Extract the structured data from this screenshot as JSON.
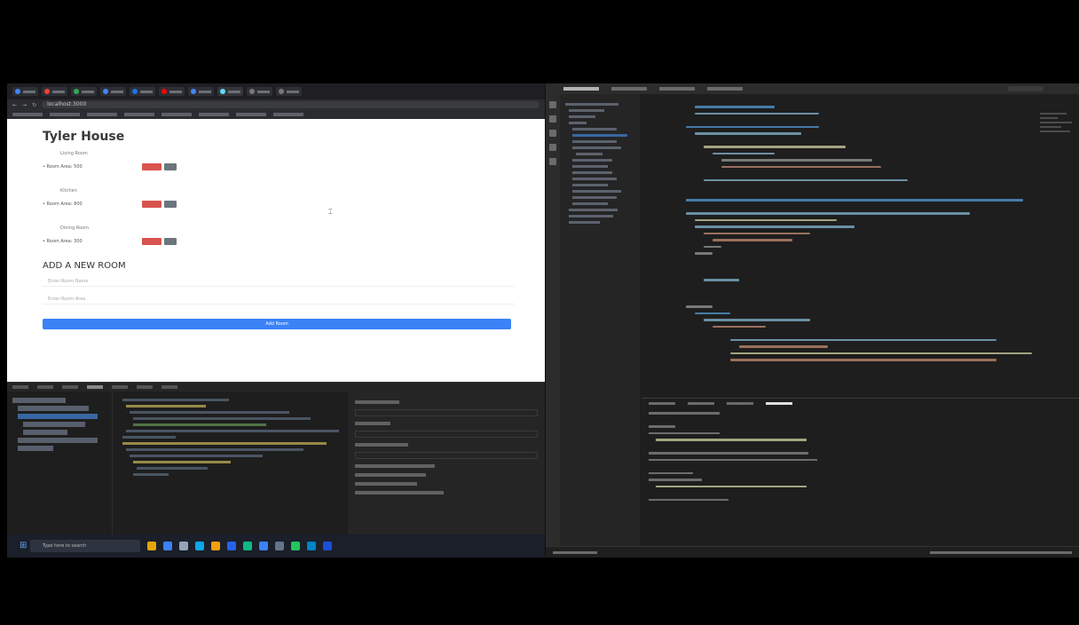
{
  "browser": {
    "address": "localhost:3000",
    "house_title": "Tyler House",
    "rooms": [
      {
        "label": "Living Room",
        "text": "• Room Area: 500"
      },
      {
        "label": "Kitchen",
        "text": "• Room Area: 800"
      },
      {
        "label": "Dining Room",
        "text": "• Room Area: 300"
      }
    ],
    "add_title": "ADD A NEW ROOM",
    "name_placeholder": "Enter Room Name",
    "area_placeholder": "Enter Room Area",
    "submit_label": "Add Room"
  },
  "taskbar": {
    "search_placeholder": "Type here to search"
  },
  "colors": {
    "delete": "#d9534f",
    "edit": "#6c757d",
    "primary": "#3b82f6",
    "editor_bg": "#1e1e1e"
  }
}
